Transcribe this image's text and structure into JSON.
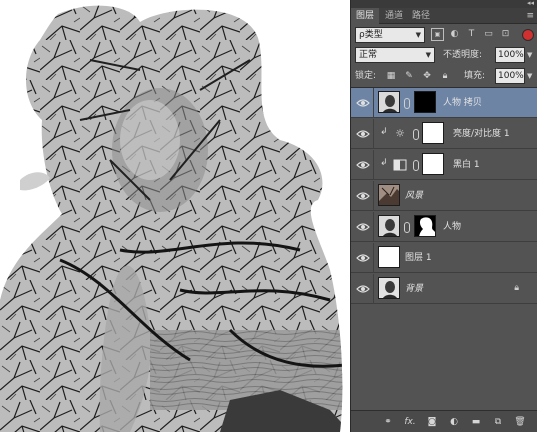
{
  "panel": {
    "tabs": [
      "图层",
      "通道",
      "路径"
    ],
    "active_tab": "图层",
    "filter": {
      "label": "ρ类型"
    },
    "blend_mode": "正常",
    "opacity_label": "不透明度:",
    "opacity_value": "100%",
    "lock_label": "锁定:",
    "fill_label": "填充:",
    "fill_value": "100%"
  },
  "layers": [
    {
      "name": "人物 拷贝",
      "selected": true,
      "type": "portrait+mask-black"
    },
    {
      "name": "亮度/对比度 1",
      "type": "adjustment-brightness",
      "clipped": true
    },
    {
      "name": "黑白 1",
      "type": "adjustment-bw",
      "clipped": true
    },
    {
      "name": "风景",
      "type": "tree"
    },
    {
      "name": "人物",
      "type": "portrait+mask-silhouette"
    },
    {
      "name": "图层 1",
      "type": "white"
    },
    {
      "name": "背景",
      "type": "portrait-bg",
      "locked": true
    }
  ],
  "icons": {
    "filter_icons": [
      "image-filter-icon",
      "adjustment-filter-icon",
      "type-filter-icon",
      "shape-filter-icon",
      "smartobject-filter-icon"
    ],
    "lock_icons": [
      "lock-pixels-icon",
      "lock-brush-icon",
      "lock-move-icon",
      "lock-all-icon"
    ],
    "bottom_icons": [
      "link-icon",
      "fx-icon",
      "mask-icon",
      "adjustment-icon",
      "group-icon",
      "new-layer-icon",
      "trash-icon"
    ]
  },
  "colors": {
    "panel_bg": "#535353",
    "selected_layer": "#6d84a5",
    "filter_toggle": "#d03030"
  }
}
